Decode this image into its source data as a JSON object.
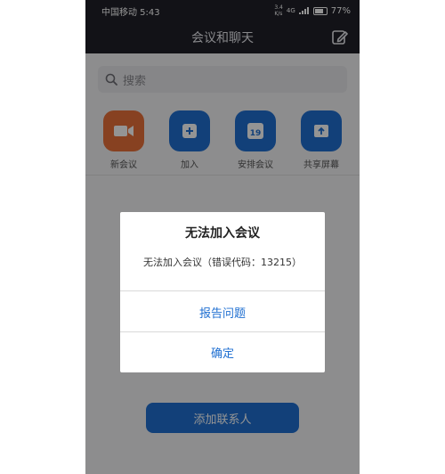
{
  "status": {
    "carrier_time": "中国移动 5:43",
    "net_speed_top": "3.4",
    "net_speed_bottom": "K/s",
    "net_type": "4G",
    "battery": "77%"
  },
  "header": {
    "title": "会议和聊天",
    "edit_icon": "edit-icon"
  },
  "search": {
    "placeholder": "搜索",
    "icon": "search-icon"
  },
  "actions": [
    {
      "label": "新会议",
      "icon": "video-camera-icon",
      "color": "#e8703a"
    },
    {
      "label": "加入",
      "icon": "plus-icon",
      "color": "#1f6fd1"
    },
    {
      "label": "安排会议",
      "icon": "calendar-icon",
      "day": "19",
      "color": "#1f6fd1"
    },
    {
      "label": "共享屏幕",
      "icon": "share-screen-icon",
      "color": "#1f6fd1"
    }
  ],
  "contacts_button": "添加联系人",
  "dialog": {
    "title": "无法加入会议",
    "message": "无法加入会议（错误代码：13215）",
    "report_button": "报告问题",
    "ok_button": "确定"
  },
  "colors": {
    "accent": "#1f6fd1",
    "new_meeting": "#e8703a",
    "header_bg": "#1f2029"
  }
}
